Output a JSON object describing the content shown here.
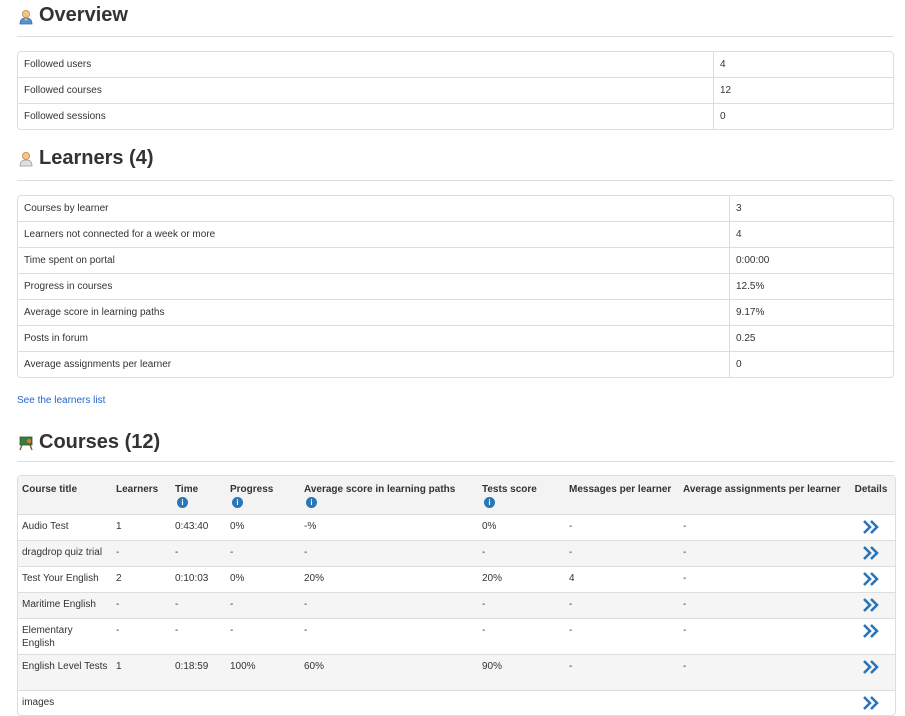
{
  "overview": {
    "title": "Overview",
    "rows": [
      {
        "label": "Followed users",
        "value": "4"
      },
      {
        "label": "Followed courses",
        "value": "12"
      },
      {
        "label": "Followed sessions",
        "value": "0"
      }
    ]
  },
  "learners": {
    "title": "Learners (4)",
    "rows": [
      {
        "label": "Courses by learner",
        "value": "3"
      },
      {
        "label": "Learners not connected for a week or more",
        "value": "4"
      },
      {
        "label": "Time spent on portal",
        "value": "0:00:00"
      },
      {
        "label": "Progress in courses",
        "value": "12.5%"
      },
      {
        "label": "Average score in learning paths",
        "value": "9.17%"
      },
      {
        "label": "Posts in forum",
        "value": "0.25"
      },
      {
        "label": "Average assignments per learner",
        "value": "0"
      }
    ],
    "see_list_link": "See the learners list"
  },
  "courses": {
    "title": "Courses (12)",
    "headers": [
      "Course title",
      "Learners",
      "Time",
      "Progress",
      "Average score in learning paths",
      "Tests score",
      "Messages per learner",
      "Average assignments per learner",
      "Details"
    ],
    "rows": [
      [
        "Audio Test",
        "1",
        "0:43:40",
        "0%",
        "-%",
        "0%",
        "-",
        "-"
      ],
      [
        "dragdrop quiz trial",
        "-",
        "-",
        "-",
        "-",
        "-",
        "-",
        "-"
      ],
      [
        "Test Your English",
        "2",
        "0:10:03",
        "0%",
        "20%",
        "20%",
        "4",
        "-"
      ],
      [
        "Maritime English",
        "-",
        "-",
        "-",
        "-",
        "-",
        "-",
        "-"
      ],
      [
        "Elementary English",
        "-",
        "-",
        "-",
        "-",
        "-",
        "-",
        "-"
      ],
      [
        "English Level Tests",
        "1",
        "0:18:59",
        "100%",
        "60%",
        "90%",
        "-",
        "-"
      ],
      [
        "images",
        "",
        "",
        "",
        "",
        "",
        "",
        ""
      ]
    ]
  },
  "colors": {
    "link": "#2266cc",
    "details_icon": "#2a74b8",
    "info_icon": "#2a74b8"
  },
  "icons": {
    "overview": "user-icon",
    "learners": "user-icon",
    "courses": "course-icon",
    "details": "double-chevron-right-icon",
    "info": "info-icon"
  }
}
